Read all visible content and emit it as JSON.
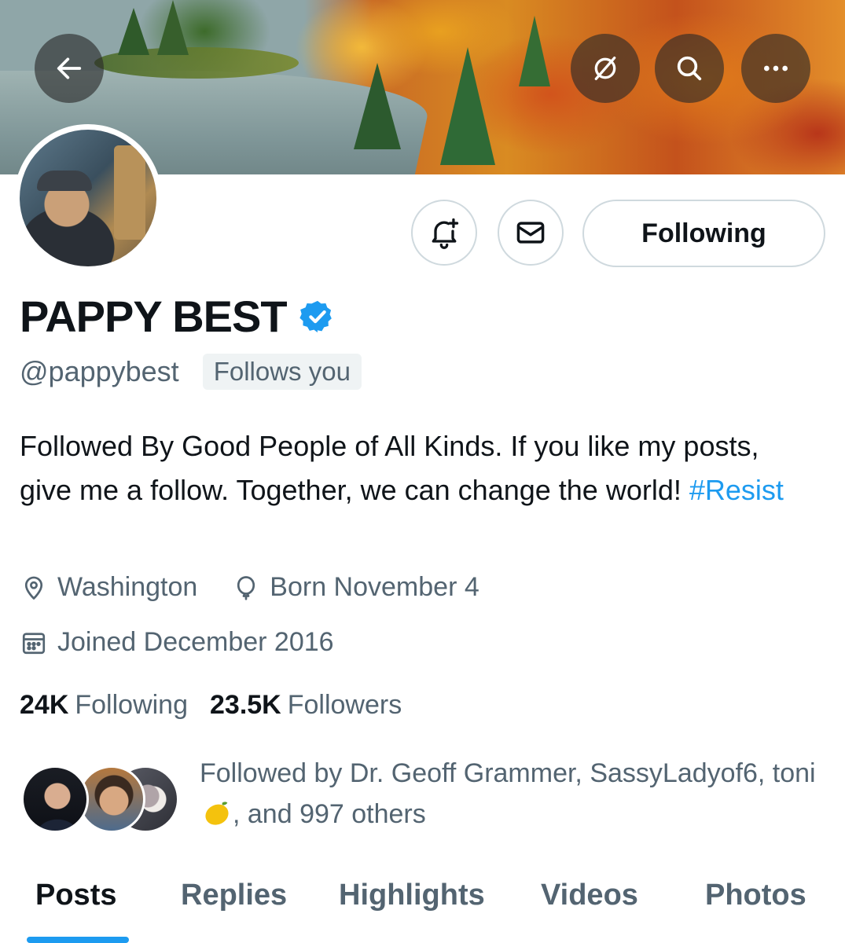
{
  "profile": {
    "display_name": "PAPPY BEST",
    "handle": "@pappybest",
    "follows_you_badge": "Follows you",
    "bio_text": "Followed By Good People of All Kinds. If you like my posts, give me a follow. Together, we can change the world! ",
    "bio_hashtag": "#Resist",
    "location": "Washington",
    "birthday": "Born November 4",
    "joined": "Joined December 2016"
  },
  "stats": {
    "following_count": "24K",
    "following_label": "Following",
    "followers_count": "23.5K",
    "followers_label": "Followers"
  },
  "actions": {
    "following_button": "Following"
  },
  "followed_by": {
    "text_before": "Followed by Dr. Geoff Grammer, SassyLadyof6, toni ",
    "text_after": ", and 997 others",
    "emoji_icon": "lemon-emoji"
  },
  "tabs": [
    {
      "label": "Posts",
      "active": true
    },
    {
      "label": "Replies",
      "active": false
    },
    {
      "label": "Highlights",
      "active": false
    },
    {
      "label": "Videos",
      "active": false
    },
    {
      "label": "Photos",
      "active": false
    }
  ],
  "icons": {
    "back": "arrow-left-icon",
    "grok": "slash-circle-icon",
    "search": "search-icon",
    "more": "more-icon",
    "notify": "bell-plus-icon",
    "message": "envelope-icon",
    "verified": "verified-badge-icon",
    "location": "location-pin-icon",
    "birthday": "balloon-icon",
    "calendar": "calendar-icon"
  },
  "colors": {
    "accent": "#1d9bf0",
    "text_primary": "#0f1419",
    "text_secondary": "#536471",
    "border": "#cfd9de"
  }
}
